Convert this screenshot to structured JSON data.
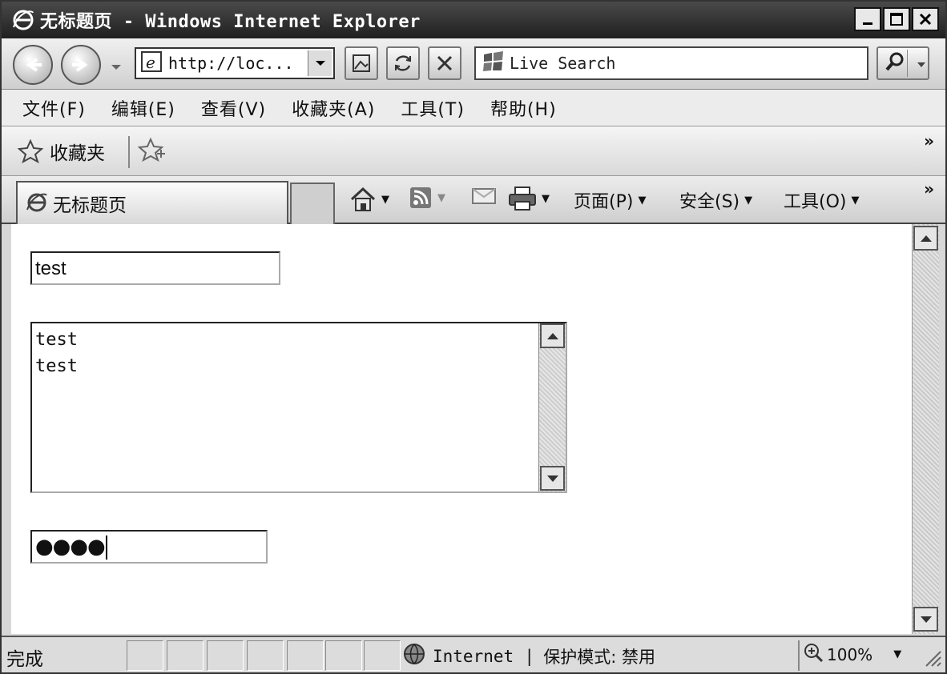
{
  "window": {
    "title": "无标题页 - Windows Internet Explorer"
  },
  "toolbar": {
    "address": "http://loc...",
    "search_placeholder": "Live Search"
  },
  "menu": [
    "文件(F)",
    "编辑(E)",
    "查看(V)",
    "收藏夹(A)",
    "工具(T)",
    "帮助(H)"
  ],
  "favorites": {
    "label": "收藏夹",
    "chevron": "»"
  },
  "tab": {
    "title": "无标题页"
  },
  "commands": {
    "page": "页面(P)",
    "safety": "安全(S)",
    "tools": "工具(O)",
    "chevron": "»"
  },
  "form": {
    "text_value": "test",
    "textarea_lines": [
      "test",
      "test"
    ],
    "password_mask": "●●●●"
  },
  "status": {
    "text": "完成",
    "zone": "Internet",
    "separator": "|",
    "protected_mode": "保护模式: 禁用",
    "zoom": "100%"
  }
}
